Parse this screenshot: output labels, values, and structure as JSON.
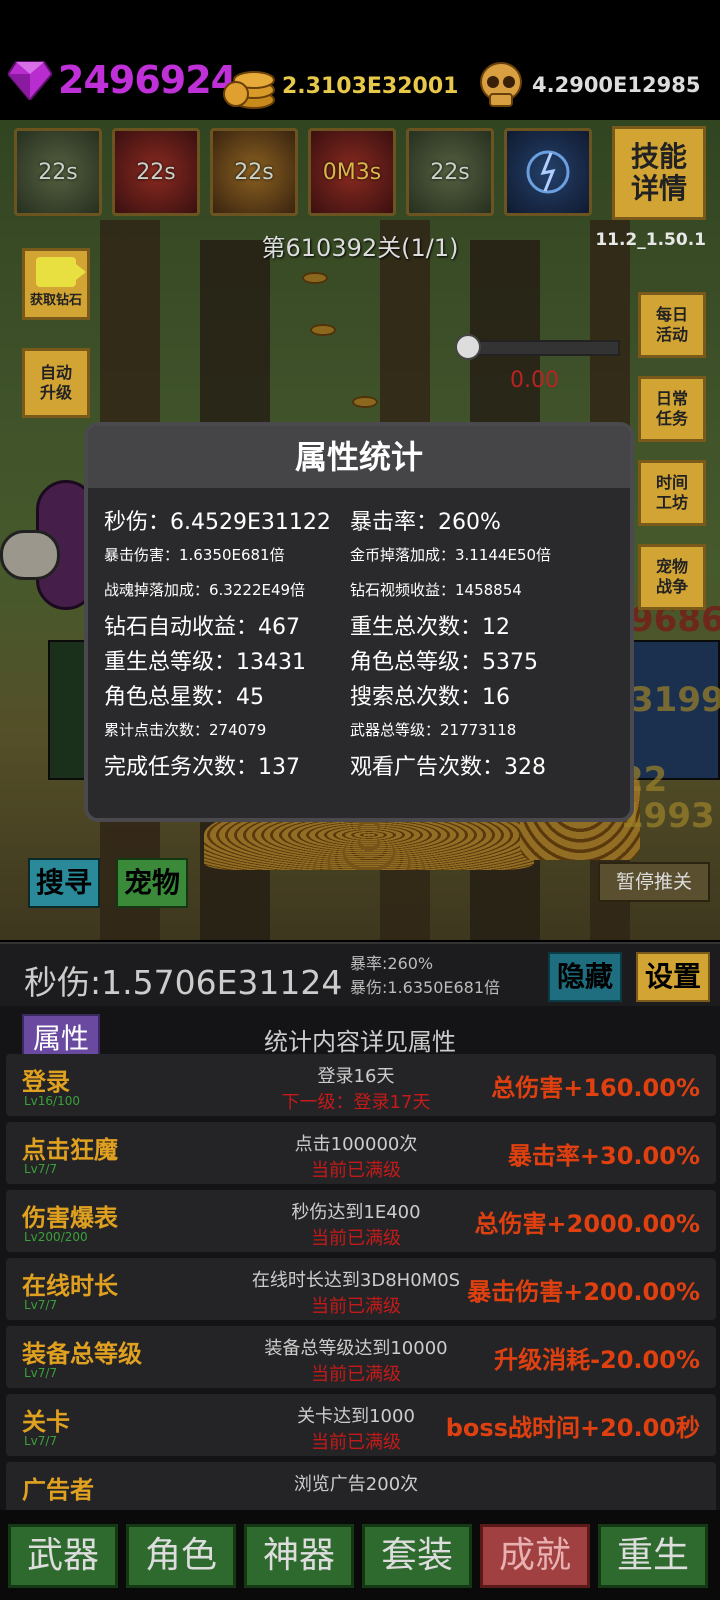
{
  "currencies": {
    "gems": "2496924",
    "gold": "2.3103E32001",
    "souls": "4.2900E12985"
  },
  "skills": [
    {
      "timer": "22s",
      "icon": "claw-skill-icon"
    },
    {
      "timer": "22s",
      "icon": "fire-slash-skill-icon"
    },
    {
      "timer": "22s",
      "icon": "star-skill-icon"
    },
    {
      "timer": "0M3s",
      "icon": "warrior-skill-icon"
    },
    {
      "timer": "22s",
      "icon": "arrow-skill-icon"
    },
    {
      "timer": "",
      "icon": "lightning-skill-icon"
    }
  ],
  "skill_info_button": "技能详情",
  "stage": "第610392关(1/1)",
  "version": "11.2_1.50.1",
  "left_buttons": {
    "get_gems": "获取钻石",
    "auto_upgrade": "自动升级"
  },
  "right_buttons": [
    "每日活动",
    "日常任务",
    "时间工坊",
    "宠物战争"
  ],
  "boss_hp_value": "0.00",
  "game_buttons": {
    "search": "搜寻",
    "pet": "宠物",
    "pause": "暂停推关"
  },
  "modal": {
    "title": "属性统计",
    "rows": [
      [
        {
          "label": "秒伤：6.4529E31122",
          "size": "big"
        },
        {
          "label": "暴击率：260%",
          "size": "big"
        }
      ],
      [
        {
          "label": "暴击伤害：1.6350E681倍",
          "size": "small"
        },
        {
          "label": "金币掉落加成：3.1144E50倍",
          "size": "small"
        }
      ],
      [
        {
          "label": "战魂掉落加成：6.3222E49倍",
          "size": "small"
        },
        {
          "label": "钻石视频收益：1458854",
          "size": "small"
        }
      ],
      [
        {
          "label": "钻石自动收益：467",
          "size": "big"
        },
        {
          "label": "重生总次数：12",
          "size": "big"
        }
      ],
      [
        {
          "label": "重生总等级：13431",
          "size": "big"
        },
        {
          "label": "角色总等级：5375",
          "size": "big"
        }
      ],
      [
        {
          "label": "角色总星数：45",
          "size": "big"
        },
        {
          "label": "搜索总次数：16",
          "size": "big"
        }
      ],
      [
        {
          "label": "累计点击次数：274079",
          "size": "small"
        },
        {
          "label": "武器总等级：21773118",
          "size": "small"
        }
      ],
      [
        {
          "label": "完成任务次数：137",
          "size": "big"
        },
        {
          "label": "观看广告次数：328",
          "size": "big"
        }
      ]
    ]
  },
  "dps_bar": {
    "dps": "秒伤:1.5706E31124",
    "crit_rate": "暴率:260%",
    "crit_damage": "暴伤:1.6350E681倍",
    "hide": "隐藏",
    "settings": "设置"
  },
  "panel": {
    "tab": "属性",
    "description": "统计内容详见属性",
    "achievements": [
      {
        "name": "登录",
        "level": "Lv16/100",
        "requirement": "登录16天",
        "state": "下一级：登录17天",
        "bonus": "总伤害+160.00%"
      },
      {
        "name": "点击狂魔",
        "level": "Lv7/7",
        "requirement": "点击100000次",
        "state": "当前已满级",
        "bonus": "暴击率+30.00%"
      },
      {
        "name": "伤害爆表",
        "level": "Lv200/200",
        "requirement": "秒伤达到1E400",
        "state": "当前已满级",
        "bonus": "总伤害+2000.00%"
      },
      {
        "name": "在线时长",
        "level": "Lv7/7",
        "requirement": "在线时长达到3D8H0M0S",
        "state": "当前已满级",
        "bonus": "暴击伤害+200.00%"
      },
      {
        "name": "装备总等级",
        "level": "Lv7/7",
        "requirement": "装备总等级达到10000",
        "state": "当前已满级",
        "bonus": "升级消耗-20.00%"
      },
      {
        "name": "关卡",
        "level": "Lv7/7",
        "requirement": "关卡达到1000",
        "state": "当前已满级",
        "bonus": "boss战时间+20.00秒"
      },
      {
        "name": "广告者",
        "level": "",
        "requirement": "浏览广告200次",
        "state": "",
        "bonus": ""
      }
    ]
  },
  "nav": [
    {
      "label": "武器",
      "active": false
    },
    {
      "label": "角色",
      "active": false
    },
    {
      "label": "神器",
      "active": false
    },
    {
      "label": "套装",
      "active": false
    },
    {
      "label": "成就",
      "active": true
    },
    {
      "label": "重生",
      "active": false
    }
  ]
}
